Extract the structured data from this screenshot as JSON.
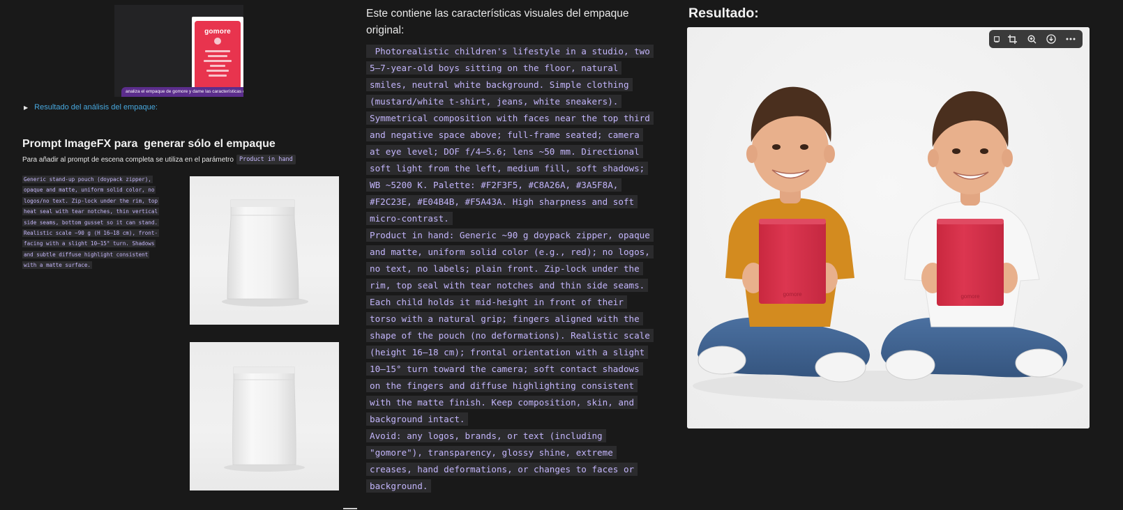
{
  "left": {
    "thumbnail": {
      "brand": "gomore",
      "caption": "analiza el empaque de gomore y dame las características de e"
    },
    "details_summary": "Resultado del análisis del empaque:",
    "section_title": "Prompt ImageFX para  generar sólo el empaque",
    "subline_text": "Para añadir al prompt de escena completa se utiliza en el parámetro",
    "subline_code": "Product in hand",
    "code_lines": [
      "Generic stand-up pouch (doypack zipper),",
      "opaque and matte, uniform solid color, no",
      "logos/no text. Zip-lock under the rim, top",
      "heat seal with tear notches, thin vertical",
      "side seams, bottom gusset so it can stand.",
      "Realistic scale ~90 g (H 16–18 cm), front-",
      "facing with a slight 10–15° turn. Shadows",
      "and subtle diffuse highlight consistent",
      "with a matte surface."
    ]
  },
  "middle": {
    "intro": "Este contiene las características visuales del empaque original:",
    "paragraphs": [
      [
        " Photorealistic children's lifestyle in a studio, two",
        "5–7-year-old boys sitting on the floor, natural",
        "smiles, neutral white background. Simple clothing",
        "(mustard/white t-shirt, jeans, white sneakers).",
        "Symmetrical composition with faces near the top third",
        "and negative space above; full-frame seated; camera",
        "at eye level; DOF f/4–5.6; lens ~50 mm. Directional",
        "soft light from the left, medium fill, soft shadows;",
        "WB ~5200 K. Palette: #F2F3F5, #C8A26A, #3A5F8A,",
        "#F2C23E, #E04B4B, #F5A43A. High sharpness and soft",
        "micro-contrast."
      ],
      [
        "Product in hand: Generic ~90 g doypack zipper, opaque",
        "and matte, uniform solid color (e.g., red); no logos,",
        "no text, no labels; plain front. Zip-lock under the",
        "rim, top seal with tear notches and thin side seams.",
        "Each child holds it mid-height in front of their",
        "torso with a natural grip; fingers aligned with the",
        "shape of the pouch (no deformations). Realistic scale",
        "(height 16–18 cm); frontal orientation with a slight",
        "10–15° turn toward the camera; soft contact shadows",
        "on the fingers and diffuse highlighting consistent",
        "with the matte finish. Keep composition, skin, and",
        "background intact."
      ],
      [
        "Avoid: any logos, brands, or text (including",
        "\"gomore\"), transparency, glossy shine, extreme",
        "creases, hand deformations, or changes to faces or",
        "background."
      ]
    ]
  },
  "right": {
    "title": "Resultado:",
    "pouch_brand": "gomore",
    "colors": {
      "mustard_shirt": "#D38B1F",
      "white_shirt": "#F7F7F7",
      "jeans": "#3E6391",
      "pouch_red": "#D9304A",
      "skin": "#E8B08C",
      "hair": "#4A2F1E"
    },
    "toolbar_icons": [
      "edit-icon",
      "crop-icon",
      "zoom-in-icon",
      "download-icon",
      "more-icon"
    ]
  }
}
